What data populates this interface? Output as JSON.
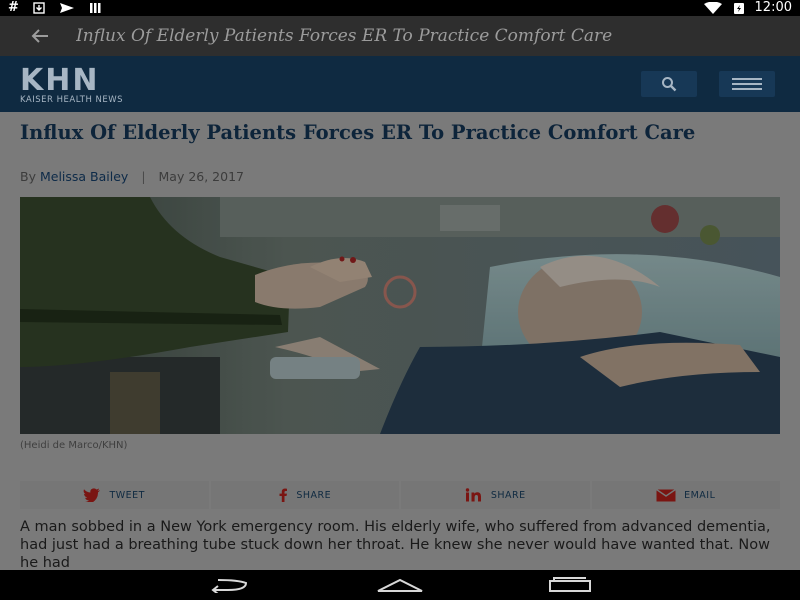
{
  "status_bar": {
    "left_icons": [
      "hash-icon",
      "download-icon",
      "send-icon",
      "storage-icon"
    ],
    "right_icons": [
      "wifi-icon",
      "battery-icon"
    ],
    "time": "12:00"
  },
  "toolbar": {
    "title": "Influx Of Elderly Patients Forces ER To Practice Comfort Care"
  },
  "site_header": {
    "logo_mark": "KHN",
    "logo_sub": "KAISER HEALTH NEWS"
  },
  "article": {
    "headline": "Influx Of Elderly Patients Forces ER To Practice Comfort Care",
    "by_prefix": "By",
    "author": "Melissa Bailey",
    "separator": "|",
    "date": "May 26, 2017",
    "caption": "(Heidi de Marco/KHN)",
    "body": "A man sobbed in a New York emergency room. His elderly wife, who suffered from advanced dementia, had just had a breathing tube stuck down her throat. He knew she never would have wanted that. Now he had"
  },
  "share": [
    {
      "label": "TWEET",
      "icon": "twitter-icon"
    },
    {
      "label": "SHARE",
      "icon": "facebook-icon"
    },
    {
      "label": "SHARE",
      "icon": "linkedin-icon"
    },
    {
      "label": "EMAIL",
      "icon": "email-icon"
    }
  ],
  "nav_bar": {
    "buttons": [
      "back-nav-icon",
      "home-nav-icon",
      "recents-nav-icon"
    ]
  },
  "colors": {
    "header_navy": "#0f2a41",
    "scrim_gray": "#7a7a7a",
    "toolbar": "#2e2e2e"
  }
}
